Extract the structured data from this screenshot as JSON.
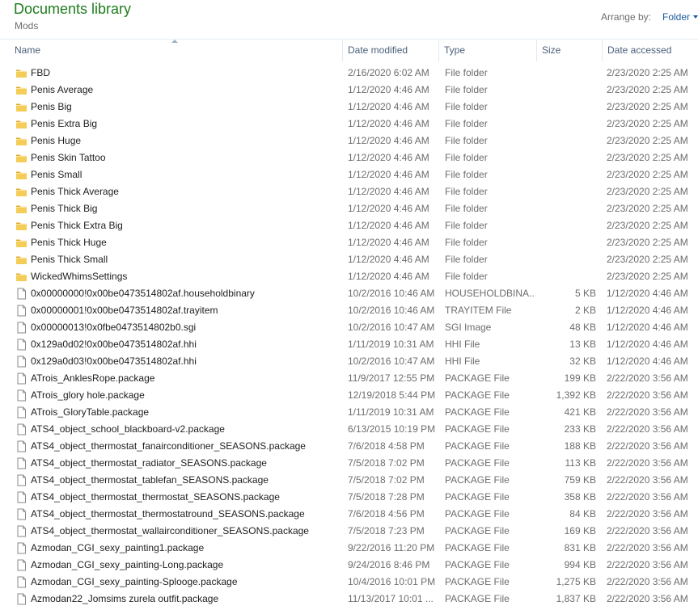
{
  "header": {
    "title": "Documents library",
    "subtitle": "Mods",
    "arrange_label": "Arrange by:",
    "arrange_value": "Folder"
  },
  "columns": {
    "name": "Name",
    "date_modified": "Date modified",
    "type": "Type",
    "size": "Size",
    "date_accessed": "Date accessed"
  },
  "icons": {
    "folder": "folder-icon",
    "file": "file-icon"
  },
  "colors": {
    "title": "#1e7d1e",
    "link": "#1e5a9e",
    "folder": "#e8b73a"
  },
  "files": [
    {
      "kind": "folder",
      "name": "FBD",
      "date": "2/16/2020 6:02 AM",
      "type": "File folder",
      "size": "",
      "accessed": "2/23/2020 2:25 AM"
    },
    {
      "kind": "folder",
      "name": "Penis Average",
      "date": "1/12/2020 4:46 AM",
      "type": "File folder",
      "size": "",
      "accessed": "2/23/2020 2:25 AM"
    },
    {
      "kind": "folder",
      "name": "Penis Big",
      "date": "1/12/2020 4:46 AM",
      "type": "File folder",
      "size": "",
      "accessed": "2/23/2020 2:25 AM"
    },
    {
      "kind": "folder",
      "name": "Penis Extra Big",
      "date": "1/12/2020 4:46 AM",
      "type": "File folder",
      "size": "",
      "accessed": "2/23/2020 2:25 AM"
    },
    {
      "kind": "folder",
      "name": "Penis Huge",
      "date": "1/12/2020 4:46 AM",
      "type": "File folder",
      "size": "",
      "accessed": "2/23/2020 2:25 AM"
    },
    {
      "kind": "folder",
      "name": "Penis Skin Tattoo",
      "date": "1/12/2020 4:46 AM",
      "type": "File folder",
      "size": "",
      "accessed": "2/23/2020 2:25 AM"
    },
    {
      "kind": "folder",
      "name": "Penis Small",
      "date": "1/12/2020 4:46 AM",
      "type": "File folder",
      "size": "",
      "accessed": "2/23/2020 2:25 AM"
    },
    {
      "kind": "folder",
      "name": "Penis Thick Average",
      "date": "1/12/2020 4:46 AM",
      "type": "File folder",
      "size": "",
      "accessed": "2/23/2020 2:25 AM"
    },
    {
      "kind": "folder",
      "name": "Penis Thick Big",
      "date": "1/12/2020 4:46 AM",
      "type": "File folder",
      "size": "",
      "accessed": "2/23/2020 2:25 AM"
    },
    {
      "kind": "folder",
      "name": "Penis Thick Extra Big",
      "date": "1/12/2020 4:46 AM",
      "type": "File folder",
      "size": "",
      "accessed": "2/23/2020 2:25 AM"
    },
    {
      "kind": "folder",
      "name": "Penis Thick Huge",
      "date": "1/12/2020 4:46 AM",
      "type": "File folder",
      "size": "",
      "accessed": "2/23/2020 2:25 AM"
    },
    {
      "kind": "folder",
      "name": "Penis Thick Small",
      "date": "1/12/2020 4:46 AM",
      "type": "File folder",
      "size": "",
      "accessed": "2/23/2020 2:25 AM"
    },
    {
      "kind": "folder",
      "name": "WickedWhimsSettings",
      "date": "1/12/2020 4:46 AM",
      "type": "File folder",
      "size": "",
      "accessed": "2/23/2020 2:25 AM"
    },
    {
      "kind": "file",
      "name": "0x00000000!0x00be0473514802af.householdbinary",
      "date": "10/2/2016 10:46 AM",
      "type": "HOUSEHOLDBINA...",
      "size": "5 KB",
      "accessed": "1/12/2020 4:46 AM"
    },
    {
      "kind": "file",
      "name": "0x00000001!0x00be0473514802af.trayitem",
      "date": "10/2/2016 10:46 AM",
      "type": "TRAYITEM File",
      "size": "2 KB",
      "accessed": "1/12/2020 4:46 AM"
    },
    {
      "kind": "file",
      "name": "0x00000013!0x0fbe0473514802b0.sgi",
      "date": "10/2/2016 10:47 AM",
      "type": "SGI Image",
      "size": "48 KB",
      "accessed": "1/12/2020 4:46 AM"
    },
    {
      "kind": "file",
      "name": "0x129a0d02!0x00be0473514802af.hhi",
      "date": "1/11/2019 10:31 AM",
      "type": "HHI File",
      "size": "13 KB",
      "accessed": "1/12/2020 4:46 AM"
    },
    {
      "kind": "file",
      "name": "0x129a0d03!0x00be0473514802af.hhi",
      "date": "10/2/2016 10:47 AM",
      "type": "HHI File",
      "size": "32 KB",
      "accessed": "1/12/2020 4:46 AM"
    },
    {
      "kind": "file",
      "name": "ATrois_AnklesRope.package",
      "date": "11/9/2017 12:55 PM",
      "type": "PACKAGE File",
      "size": "199 KB",
      "accessed": "2/22/2020 3:56 AM"
    },
    {
      "kind": "file",
      "name": "ATrois_glory hole.package",
      "date": "12/19/2018 5:44 PM",
      "type": "PACKAGE File",
      "size": "1,392 KB",
      "accessed": "2/22/2020 3:56 AM"
    },
    {
      "kind": "file",
      "name": "ATrois_GloryTable.package",
      "date": "1/11/2019 10:31 AM",
      "type": "PACKAGE File",
      "size": "421 KB",
      "accessed": "2/22/2020 3:56 AM"
    },
    {
      "kind": "file",
      "name": "ATS4_object_school_blackboard-v2.package",
      "date": "6/13/2015 10:19 PM",
      "type": "PACKAGE File",
      "size": "233 KB",
      "accessed": "2/22/2020 3:56 AM"
    },
    {
      "kind": "file",
      "name": "ATS4_object_thermostat_fanairconditioner_SEASONS.package",
      "date": "7/6/2018 4:58 PM",
      "type": "PACKAGE File",
      "size": "188 KB",
      "accessed": "2/22/2020 3:56 AM"
    },
    {
      "kind": "file",
      "name": "ATS4_object_thermostat_radiator_SEASONS.package",
      "date": "7/5/2018 7:02 PM",
      "type": "PACKAGE File",
      "size": "113 KB",
      "accessed": "2/22/2020 3:56 AM"
    },
    {
      "kind": "file",
      "name": "ATS4_object_thermostat_tablefan_SEASONS.package",
      "date": "7/5/2018 7:02 PM",
      "type": "PACKAGE File",
      "size": "759 KB",
      "accessed": "2/22/2020 3:56 AM"
    },
    {
      "kind": "file",
      "name": "ATS4_object_thermostat_thermostat_SEASONS.package",
      "date": "7/5/2018 7:28 PM",
      "type": "PACKAGE File",
      "size": "358 KB",
      "accessed": "2/22/2020 3:56 AM"
    },
    {
      "kind": "file",
      "name": "ATS4_object_thermostat_thermostatround_SEASONS.package",
      "date": "7/6/2018 4:56 PM",
      "type": "PACKAGE File",
      "size": "84 KB",
      "accessed": "2/22/2020 3:56 AM"
    },
    {
      "kind": "file",
      "name": "ATS4_object_thermostat_wallairconditioner_SEASONS.package",
      "date": "7/5/2018 7:23 PM",
      "type": "PACKAGE File",
      "size": "169 KB",
      "accessed": "2/22/2020 3:56 AM"
    },
    {
      "kind": "file",
      "name": "Azmodan_CGI_sexy_painting1.package",
      "date": "9/22/2016 11:20 PM",
      "type": "PACKAGE File",
      "size": "831 KB",
      "accessed": "2/22/2020 3:56 AM"
    },
    {
      "kind": "file",
      "name": "Azmodan_CGI_sexy_painting-Long.package",
      "date": "9/24/2016 8:46 PM",
      "type": "PACKAGE File",
      "size": "994 KB",
      "accessed": "2/22/2020 3:56 AM"
    },
    {
      "kind": "file",
      "name": "Azmodan_CGI_sexy_painting-Splooge.package",
      "date": "10/4/2016 10:01 PM",
      "type": "PACKAGE File",
      "size": "1,275 KB",
      "accessed": "2/22/2020 3:56 AM"
    },
    {
      "kind": "file",
      "name": "Azmodan22_Jomsims zurela outfit.package",
      "date": "11/13/2017 10:01 ...",
      "type": "PACKAGE File",
      "size": "1,837 KB",
      "accessed": "2/22/2020 3:56 AM"
    }
  ]
}
